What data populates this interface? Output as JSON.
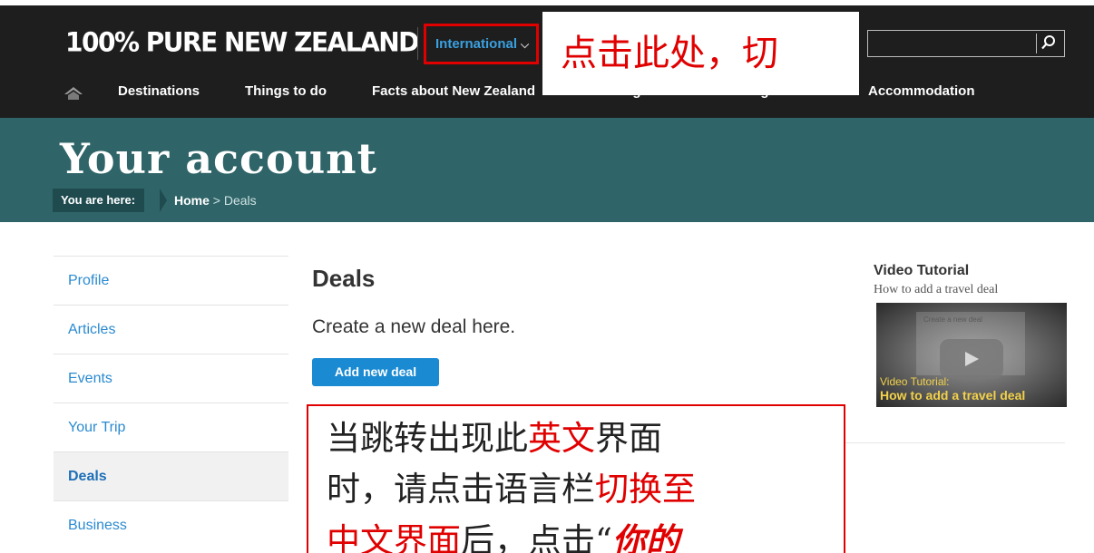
{
  "header": {
    "logo": "100% PURE NEW ZEALAND",
    "region_selector": "International",
    "callout": "点击此处，切",
    "search": {
      "value": ""
    }
  },
  "nav": {
    "items": [
      "Destinations",
      "Things to do",
      "Facts about New Zealand",
      "Getting here",
      "Getting around",
      "Accommodation"
    ]
  },
  "hero": {
    "title": "Your account",
    "breadcrumb_label": "You are here:",
    "breadcrumb_home": "Home",
    "breadcrumb_sep": ">",
    "breadcrumb_current": "Deals"
  },
  "sidebar": {
    "items": [
      "Profile",
      "Articles",
      "Events",
      "Your Trip",
      "Deals",
      "Business"
    ],
    "active": "Deals"
  },
  "main": {
    "title": "Deals",
    "description": "Create a new deal here.",
    "add_button": "Add new deal"
  },
  "callout_main": {
    "line1_a": "当跳转出现此",
    "line1_b": "英文",
    "line1_c": "界面",
    "line2_a": "时，请点击语言栏",
    "line2_b": "切换至",
    "line3_a": "中文界面",
    "line3_b": "后，点击“",
    "line3_c": "你的"
  },
  "video": {
    "heading": "Video Tutorial",
    "subtitle": "How to add a travel deal",
    "thumb_doc_title": "Create a new deal",
    "caption_small": "Video Tutorial:",
    "caption_large": "How to add a travel deal"
  },
  "colors": {
    "topbar": "#1e1e1e",
    "hero": "#2f6468",
    "link": "#2a8ad0",
    "button": "#1a8ad2",
    "annotation_red": "#e00000",
    "video_caption": "#f2d14a"
  }
}
